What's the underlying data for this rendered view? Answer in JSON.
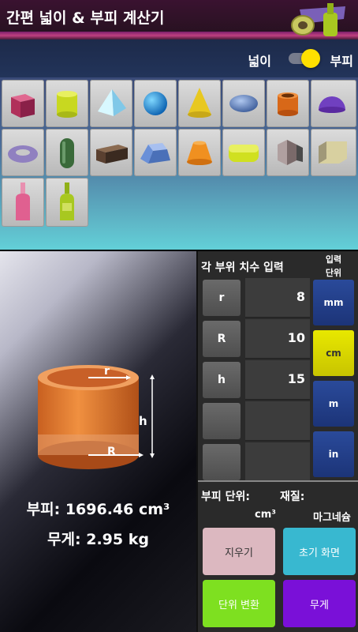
{
  "app": {
    "title": "간편 넓이 & 부피 계산기"
  },
  "mode_toggle": {
    "area_label": "넓이",
    "volume_label": "부피",
    "selected": "volume"
  },
  "shapes": [
    {
      "icon": "cube-icon",
      "color": "#b0305a"
    },
    {
      "icon": "cylinder-icon",
      "color": "#c8d820"
    },
    {
      "icon": "pyramid-icon",
      "color": "#a8e8f8"
    },
    {
      "icon": "sphere-icon",
      "color": "#1a90e0"
    },
    {
      "icon": "cone-icon",
      "color": "#e8c820"
    },
    {
      "icon": "ellipsoid-icon",
      "color": "#5a7ab8"
    },
    {
      "icon": "hollow-cylinder-icon",
      "color": "#d86818"
    },
    {
      "icon": "hemisphere-icon",
      "color": "#7040c0"
    },
    {
      "icon": "torus-icon",
      "color": "#9080c0"
    },
    {
      "icon": "capsule-icon",
      "color": "#3a6a3a"
    },
    {
      "icon": "cuboid-icon",
      "color": "#5a4030"
    },
    {
      "icon": "frustum-pyramid-icon",
      "color": "#6a90d8"
    },
    {
      "icon": "frustum-cone-icon",
      "color": "#f09020"
    },
    {
      "icon": "rounded-slab-icon",
      "color": "#d0e020"
    },
    {
      "icon": "hexagonal-prism-icon",
      "color": "#b0a0a0"
    },
    {
      "icon": "octagonal-prism-icon",
      "color": "#d8d0a0"
    },
    {
      "icon": "bottle-pink-icon",
      "color": "#e06090"
    },
    {
      "icon": "bottle-green-icon",
      "color": "#a8c820"
    }
  ],
  "preview": {
    "labels": {
      "r": "r",
      "R": "R",
      "h": "h"
    },
    "volume_text": "부피: 1696.46 cm³",
    "weight_text": "무게: 2.95 kg"
  },
  "inputs": {
    "title": "각 부위 치수 입력",
    "unit_header": "입력\n단위",
    "fields": [
      {
        "label": "r",
        "value": "8"
      },
      {
        "label": "R",
        "value": "10"
      },
      {
        "label": "h",
        "value": "15"
      },
      {
        "label": "",
        "value": ""
      },
      {
        "label": "",
        "value": ""
      }
    ],
    "units": [
      "mm",
      "cm",
      "m",
      "in"
    ],
    "selected_unit": "cm"
  },
  "settings": {
    "volume_unit_label": "부피 단위:",
    "volume_unit_value": "cm³",
    "material_label": "재질:",
    "material_value": "마그네슘"
  },
  "actions": {
    "clear": "지우기",
    "home": "초기 화면",
    "convert": "단위 변환",
    "weight": "무게"
  },
  "colors": {
    "clear_btn": "#dcb8c0",
    "home_btn": "#38b8d0",
    "convert_btn": "#7ee020",
    "weight_btn": "#7a10d8",
    "unit_active": "#e8e800",
    "unit_inactive": "#2a4a9a"
  }
}
